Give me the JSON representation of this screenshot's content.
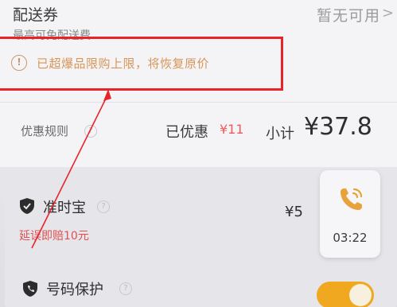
{
  "coupon": {
    "title": "配送券",
    "status": "暂无可用",
    "chevron": ">",
    "subtitle": "最高可免配送费"
  },
  "warning": {
    "icon": "!",
    "text": "已超爆品限购上限，将恢复原价"
  },
  "summary": {
    "rules_label": "优惠规则",
    "discount_label": "已优惠",
    "discount_value": "¥11",
    "subtotal_label": "小计",
    "subtotal_value": "¥37.8"
  },
  "insurance": {
    "name": "准时宝",
    "desc_prefix": "延误即赔",
    "desc_amount": "10元",
    "price": "¥5"
  },
  "call_widget": {
    "time": "03:22"
  },
  "privacy": {
    "name": "号码保护",
    "toggle_on": true
  },
  "colors": {
    "warning_text": "#d89558",
    "annotation_red": "#e8242a",
    "discount_red": "#f05a5a",
    "toggle_orange": "#f0a820",
    "phone_icon": "#e8a23a"
  }
}
